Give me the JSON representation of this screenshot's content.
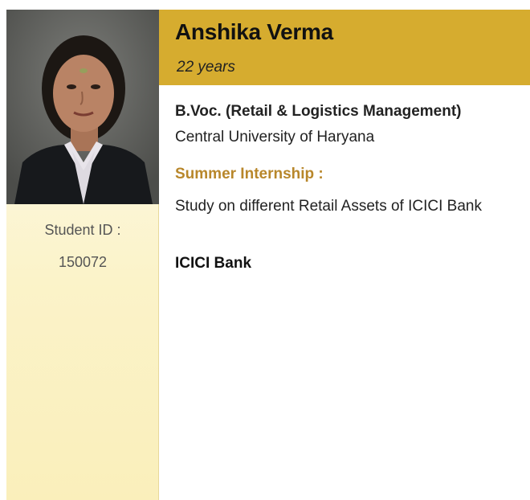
{
  "profile": {
    "name": "Anshika Verma",
    "age": "22 years",
    "student_id_label": "Student ID :",
    "student_id": "150072",
    "degree": "B.Voc. (Retail & Logistics Management)",
    "university": "Central University of Haryana",
    "section_title": "Summer Internship :",
    "project": "Study on different Retail Assets of ICICI Bank",
    "company": "ICICI Bank"
  },
  "colors": {
    "header_band": "#d6ac2f",
    "section_title": "#b8872b",
    "left_column": "#fbf3c9"
  },
  "photo": {
    "description_icon": "student-portrait"
  }
}
